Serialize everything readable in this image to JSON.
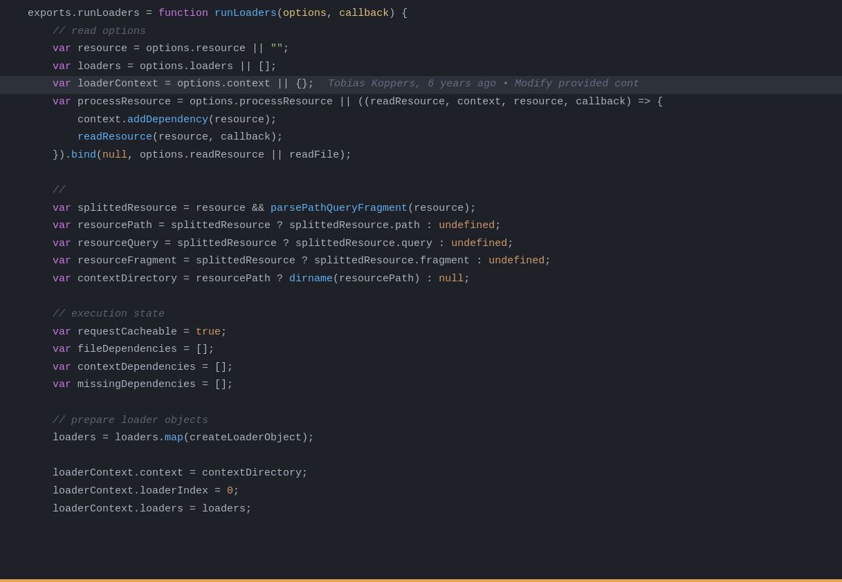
{
  "editor": {
    "background": "#1e2228",
    "lines": [
      {
        "id": 1,
        "indent": 0,
        "tokens": [
          {
            "type": "plain",
            "text": "exports.runLoaders = "
          },
          {
            "type": "kw",
            "text": "function"
          },
          {
            "type": "plain",
            "text": " "
          },
          {
            "type": "fn",
            "text": "runLoaders"
          },
          {
            "type": "punct",
            "text": "("
          },
          {
            "type": "param",
            "text": "options"
          },
          {
            "type": "punct",
            "text": ", "
          },
          {
            "type": "param",
            "text": "callback"
          },
          {
            "type": "punct",
            "text": ") {"
          }
        ]
      },
      {
        "id": 2,
        "indent": 1,
        "tokens": [
          {
            "type": "comment",
            "text": "// read options"
          }
        ]
      },
      {
        "id": 3,
        "indent": 1,
        "tokens": [
          {
            "type": "kw",
            "text": "var"
          },
          {
            "type": "plain",
            "text": " resource = options.resource || "
          },
          {
            "type": "str",
            "text": "\"\""
          },
          {
            "type": "punct",
            "text": ";"
          }
        ]
      },
      {
        "id": 4,
        "indent": 1,
        "tokens": [
          {
            "type": "kw",
            "text": "var"
          },
          {
            "type": "plain",
            "text": " loaders = options.loaders || "
          },
          {
            "type": "punct",
            "text": "[]"
          },
          {
            "type": "punct",
            "text": ";"
          }
        ]
      },
      {
        "id": 5,
        "indent": 1,
        "highlighted": true,
        "tokens": [
          {
            "type": "kw",
            "text": "var"
          },
          {
            "type": "plain",
            "text": " loaderContext = options.context || "
          },
          {
            "type": "punct",
            "text": "{};"
          }
        ],
        "blame": "Tobias Koppers, 6 years ago • Modify provided cont"
      },
      {
        "id": 6,
        "indent": 1,
        "tokens": [
          {
            "type": "kw",
            "text": "var"
          },
          {
            "type": "plain",
            "text": " processResource = options.processResource || ((readResource, context, resource, callback) => {"
          }
        ]
      },
      {
        "id": 7,
        "indent": 2,
        "tokens": [
          {
            "type": "plain",
            "text": "context."
          },
          {
            "type": "func-name",
            "text": "addDependency"
          },
          {
            "type": "plain",
            "text": "(resource);"
          }
        ]
      },
      {
        "id": 8,
        "indent": 2,
        "tokens": [
          {
            "type": "func-name",
            "text": "readResource"
          },
          {
            "type": "plain",
            "text": "(resource, callback);"
          }
        ]
      },
      {
        "id": 9,
        "indent": 1,
        "tokens": [
          {
            "type": "punct",
            "text": "})."
          },
          {
            "type": "func-name",
            "text": "bind"
          },
          {
            "type": "plain",
            "text": "("
          },
          {
            "type": "bool",
            "text": "null"
          },
          {
            "type": "plain",
            "text": ", options.readResource || readFile);"
          }
        ]
      },
      {
        "id": 10,
        "indent": 0,
        "tokens": []
      },
      {
        "id": 11,
        "indent": 1,
        "tokens": [
          {
            "type": "comment",
            "text": "//"
          }
        ]
      },
      {
        "id": 12,
        "indent": 1,
        "tokens": [
          {
            "type": "kw",
            "text": "var"
          },
          {
            "type": "plain",
            "text": " splittedResource = resource && "
          },
          {
            "type": "func-name",
            "text": "parsePathQueryFragment"
          },
          {
            "type": "plain",
            "text": "(resource);"
          }
        ]
      },
      {
        "id": 13,
        "indent": 1,
        "tokens": [
          {
            "type": "kw",
            "text": "var"
          },
          {
            "type": "plain",
            "text": " resourcePath = splittedResource ? splittedResource.path : "
          },
          {
            "type": "bool",
            "text": "undefined"
          },
          {
            "type": "plain",
            "text": ";"
          }
        ]
      },
      {
        "id": 14,
        "indent": 1,
        "tokens": [
          {
            "type": "kw",
            "text": "var"
          },
          {
            "type": "plain",
            "text": " resourceQuery = splittedResource ? splittedResource.query : "
          },
          {
            "type": "bool",
            "text": "undefined"
          },
          {
            "type": "plain",
            "text": ";"
          }
        ]
      },
      {
        "id": 15,
        "indent": 1,
        "tokens": [
          {
            "type": "kw",
            "text": "var"
          },
          {
            "type": "plain",
            "text": " resourceFragment = splittedResource ? splittedResource.fragment : "
          },
          {
            "type": "bool",
            "text": "undefined"
          },
          {
            "type": "plain",
            "text": ";"
          }
        ]
      },
      {
        "id": 16,
        "indent": 1,
        "tokens": [
          {
            "type": "kw",
            "text": "var"
          },
          {
            "type": "plain",
            "text": " contextDirectory = resourcePath ? "
          },
          {
            "type": "func-name",
            "text": "dirname"
          },
          {
            "type": "plain",
            "text": "(resourcePath) : "
          },
          {
            "type": "bool",
            "text": "null"
          },
          {
            "type": "plain",
            "text": ";"
          }
        ]
      },
      {
        "id": 17,
        "indent": 0,
        "tokens": []
      },
      {
        "id": 18,
        "indent": 1,
        "tokens": [
          {
            "type": "comment",
            "text": "// execution state"
          }
        ]
      },
      {
        "id": 19,
        "indent": 1,
        "tokens": [
          {
            "type": "kw",
            "text": "var"
          },
          {
            "type": "plain",
            "text": " requestCacheable = "
          },
          {
            "type": "bool",
            "text": "true"
          },
          {
            "type": "plain",
            "text": ";"
          }
        ]
      },
      {
        "id": 20,
        "indent": 1,
        "tokens": [
          {
            "type": "kw",
            "text": "var"
          },
          {
            "type": "plain",
            "text": " fileDependencies = [];"
          }
        ]
      },
      {
        "id": 21,
        "indent": 1,
        "tokens": [
          {
            "type": "kw",
            "text": "var"
          },
          {
            "type": "plain",
            "text": " contextDependencies = [];"
          }
        ]
      },
      {
        "id": 22,
        "indent": 1,
        "tokens": [
          {
            "type": "kw",
            "text": "var"
          },
          {
            "type": "plain",
            "text": " missingDependencies = [];"
          }
        ]
      },
      {
        "id": 23,
        "indent": 0,
        "tokens": []
      },
      {
        "id": 24,
        "indent": 1,
        "tokens": [
          {
            "type": "comment",
            "text": "// prepare loader objects"
          }
        ]
      },
      {
        "id": 25,
        "indent": 1,
        "tokens": [
          {
            "type": "plain",
            "text": "loaders = loaders."
          },
          {
            "type": "func-name",
            "text": "map"
          },
          {
            "type": "plain",
            "text": "(createLoaderObject);"
          }
        ]
      },
      {
        "id": 26,
        "indent": 0,
        "tokens": []
      },
      {
        "id": 27,
        "indent": 1,
        "tokens": [
          {
            "type": "plain",
            "text": "loaderContext.context = contextDirectory;"
          }
        ]
      },
      {
        "id": 28,
        "indent": 1,
        "tokens": [
          {
            "type": "plain",
            "text": "loaderContext.loaderIndex = "
          },
          {
            "type": "num",
            "text": "0"
          },
          {
            "type": "plain",
            "text": ";"
          }
        ]
      },
      {
        "id": 29,
        "indent": 1,
        "tokens": [
          {
            "type": "plain",
            "text": "loaderContext.loaders = loaders;"
          }
        ]
      }
    ]
  }
}
